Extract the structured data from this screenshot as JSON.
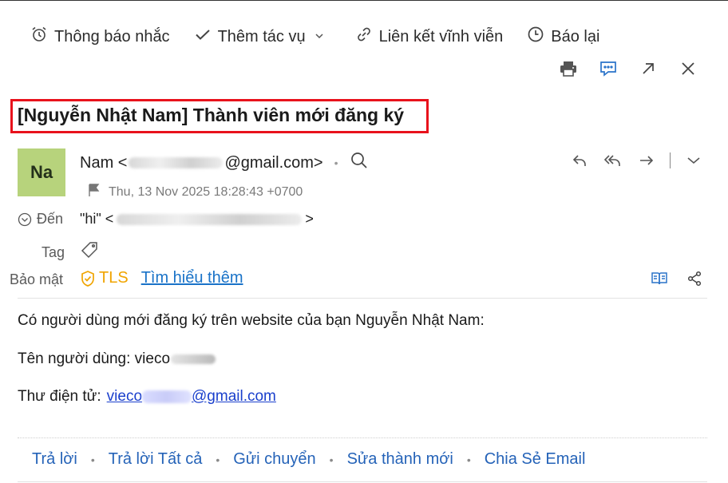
{
  "toolbar": {
    "reminder": "Thông báo nhắc",
    "add_task": "Thêm tác vụ",
    "permalink": "Liên kết vĩnh viễn",
    "report": "Báo lại"
  },
  "icons": {
    "toolbar": [
      "alarm-clock-icon",
      "checkmark-icon",
      "chevron-down-icon",
      "link-icon",
      "clock-icon"
    ],
    "actions": [
      "printer-icon",
      "chat-icon",
      "pop-out-icon",
      "close-icon"
    ],
    "reply": [
      "reply-icon",
      "reply-all-icon",
      "forward-icon",
      "chevron-down-icon"
    ],
    "meta": [
      "flag-icon",
      "expand-circle-icon",
      "tag-icon",
      "shield-check-icon",
      "reader-icon",
      "share-icon",
      "search-icon"
    ]
  },
  "subject": "[Nguyễn Nhật Nam] Thành viên mới đăng ký",
  "sender": {
    "avatar_initials": "Na",
    "avatar_color": "#b7d37c",
    "name": "Nam <",
    "email_suffix": "@gmail.com>",
    "date": "Thu, 13 Nov 2025 18:28:43 +0700"
  },
  "recipient": {
    "label": "Đến",
    "name": "\"hi\" <",
    "suffix": ">"
  },
  "tag_label": "Tag",
  "security": {
    "label": "Bảo mật",
    "protocol": "TLS",
    "learn_more": "Tìm hiểu thêm"
  },
  "body": {
    "line1": "Có người dùng mới đăng ký trên website của bạn Nguyễn Nhật Nam:",
    "username_label": "Tên người dùng: vieco",
    "email_label": "Thư điện tử:",
    "email_prefix": "vieco",
    "email_suffix": "@gmail.com"
  },
  "footer": {
    "reply": "Trả lời",
    "reply_all": "Trả lời Tất cả",
    "forward": "Gửi chuyển",
    "edit_as_new": "Sửa thành mới",
    "share_email": "Chia Sẻ Email"
  },
  "colors": {
    "highlight": "#e8121c",
    "link": "#2563b8",
    "tls": "#f0a400",
    "accent_icon": "#2a73c9"
  }
}
